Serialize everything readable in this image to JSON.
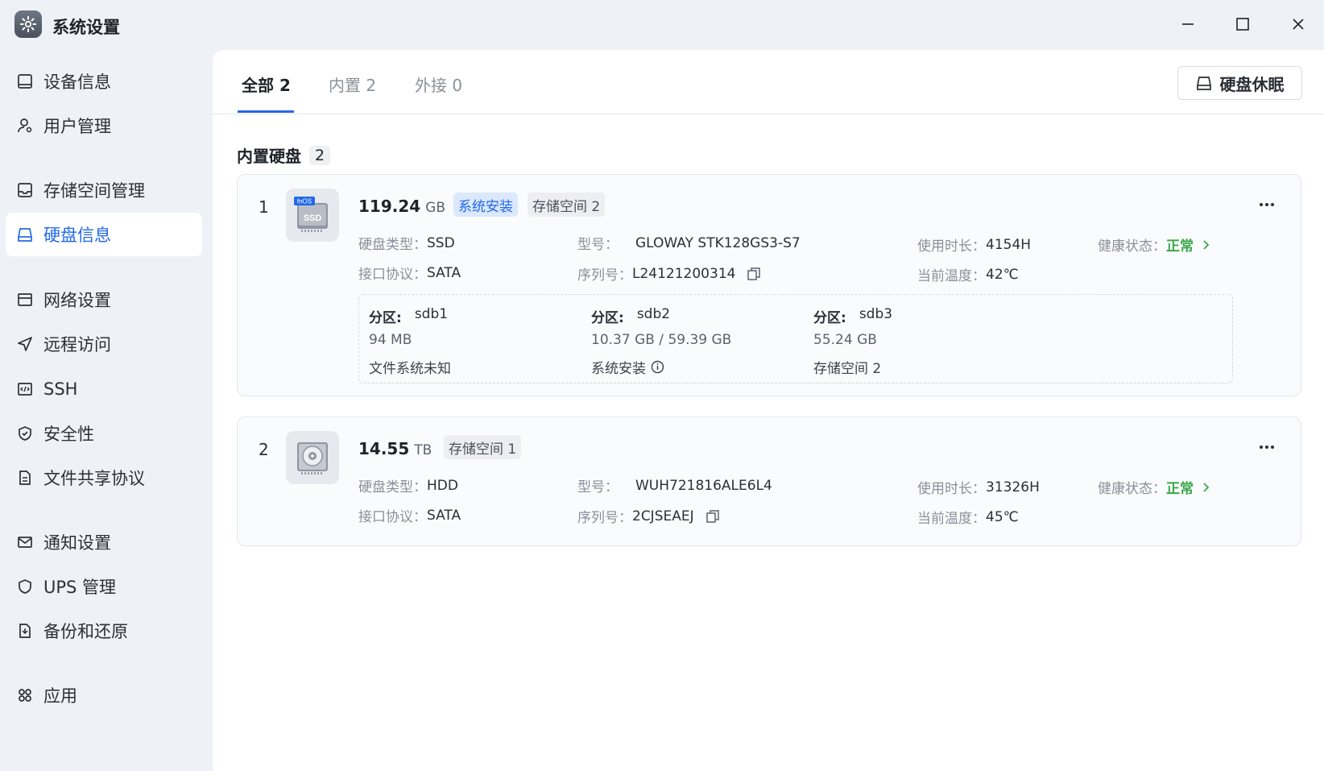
{
  "window": {
    "title": "系统设置",
    "controls": [
      "minimize",
      "maximize",
      "close"
    ]
  },
  "sidebar": {
    "items": [
      {
        "label": "设备信息",
        "icon": "device-icon",
        "active": false
      },
      {
        "label": "用户管理",
        "icon": "user-icon",
        "active": false
      },
      {
        "label": "存储空间管理",
        "icon": "storage-icon",
        "active": false
      },
      {
        "label": "硬盘信息",
        "icon": "disk-icon",
        "active": true
      },
      {
        "label": "网络设置",
        "icon": "network-icon",
        "active": false
      },
      {
        "label": "远程访问",
        "icon": "send-icon",
        "active": false
      },
      {
        "label": "SSH",
        "icon": "code-icon",
        "active": false
      },
      {
        "label": "安全性",
        "icon": "shield-check-icon",
        "active": false
      },
      {
        "label": "文件共享协议",
        "icon": "file-icon",
        "active": false
      },
      {
        "label": "通知设置",
        "icon": "mail-icon",
        "active": false
      },
      {
        "label": "UPS 管理",
        "icon": "shield-icon",
        "active": false
      },
      {
        "label": "备份和还原",
        "icon": "backup-icon",
        "active": false
      },
      {
        "label": "应用",
        "icon": "apps-icon",
        "active": false
      }
    ]
  },
  "tabs": [
    {
      "label": "全部 2",
      "active": true
    },
    {
      "label": "内置 2",
      "active": false
    },
    {
      "label": "外接 0",
      "active": false
    }
  ],
  "sleep_button": "硬盘休眠",
  "section": {
    "title": "内置硬盘",
    "count": "2"
  },
  "disks": [
    {
      "index": "1",
      "image_label": "SSD",
      "image_badge": "fnOS",
      "size": "119.24",
      "unit": "GB",
      "tags": [
        "系统安装",
        "存储空间 2"
      ],
      "type_label": "硬盘类型：",
      "type": "SSD",
      "protocol_label": "接口协议：",
      "protocol": "SATA",
      "model_label": "型号：",
      "model": "GLOWAY STK128GS3-S7",
      "serial_label": "序列号：",
      "serial": "L24121200314",
      "hours_label": "使用时长：",
      "hours": "4154H",
      "temp_label": "当前温度：",
      "temp": "42℃",
      "health_label": "健康状态：",
      "health": "正常",
      "partitions": [
        {
          "label": "分区:",
          "name": "sdb1",
          "size": "94 MB",
          "usage": "文件系统未知",
          "info": false
        },
        {
          "label": "分区:",
          "name": "sdb2",
          "size": "10.37 GB / 59.39 GB",
          "usage": "系统安装",
          "info": true
        },
        {
          "label": "分区:",
          "name": "sdb3",
          "size": "55.24 GB",
          "usage": "存储空间 2",
          "info": false
        }
      ]
    },
    {
      "index": "2",
      "size": "14.55",
      "unit": "TB",
      "tags": [
        "存储空间 1"
      ],
      "type_label": "硬盘类型：",
      "type": "HDD",
      "protocol_label": "接口协议：",
      "protocol": "SATA",
      "model_label": "型号：",
      "model": "WUH721816ALE6L4",
      "serial_label": "序列号：",
      "serial": "2CJSEAEJ",
      "hours_label": "使用时长：",
      "hours": "31326H",
      "temp_label": "当前温度：",
      "temp": "45℃",
      "health_label": "健康状态：",
      "health": "正常"
    }
  ],
  "colors": {
    "accent": "#2268e8",
    "ok": "#3aa74a",
    "background": "#eef1f6"
  }
}
